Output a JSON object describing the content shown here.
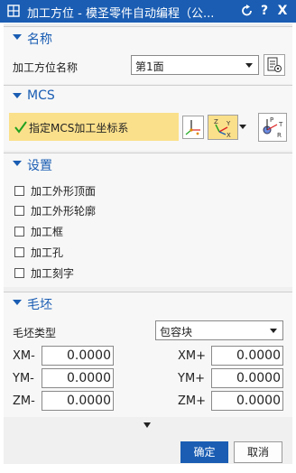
{
  "window": {
    "title": "加工方位 - 模圣零件自动编程（公...",
    "reset_icon": "refresh-icon",
    "help_label": "?",
    "close_label": "X"
  },
  "sections": {
    "name": {
      "header": "名称",
      "field_label": "加工方位名称",
      "field_value": "第1面"
    },
    "mcs": {
      "header": "MCS",
      "specify_label": "指定MCS加工坐标系"
    },
    "settings": {
      "header": "设置",
      "options": [
        {
          "label": "加工外形顶面",
          "checked": false
        },
        {
          "label": "加工外形轮廓",
          "checked": false
        },
        {
          "label": "加工框",
          "checked": false
        },
        {
          "label": "加工孔",
          "checked": false
        },
        {
          "label": "加工刻字",
          "checked": false
        }
      ]
    },
    "blank": {
      "header": "毛坯",
      "type_label": "毛坯类型",
      "type_value": "包容块",
      "xm_minus_label": "XM-",
      "xm_minus_value": "0.0000",
      "xm_plus_label": "XM+",
      "xm_plus_value": "0.0000",
      "ym_minus_label": "YM-",
      "ym_minus_value": "0.0000",
      "ym_plus_label": "YM+",
      "ym_plus_value": "0.0000",
      "zm_minus_label": "ZM-",
      "zm_minus_value": "0.0000",
      "zm_plus_label": "ZM+",
      "zm_plus_value": "0.0000"
    }
  },
  "footer": {
    "ok_label": "确定",
    "cancel_label": "取消"
  },
  "colors": {
    "title_bar": "#1a5db3",
    "section_header": "#1a5db3",
    "mcs_highlight": "#fbe08b",
    "check_green": "#1fa11f"
  }
}
